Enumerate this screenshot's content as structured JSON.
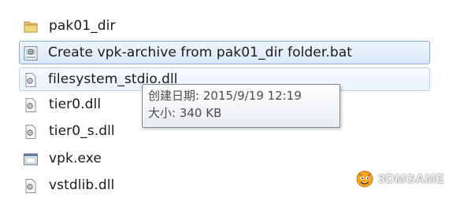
{
  "files": [
    {
      "name": "pak01_dir",
      "icon": "folder-icon"
    },
    {
      "name": "Create vpk-archive from pak01_dir folder.bat",
      "icon": "batch-file-icon"
    },
    {
      "name": "filesystem_stdio.dll",
      "icon": "dll-file-icon"
    },
    {
      "name": "tier0.dll",
      "icon": "dll-file-icon"
    },
    {
      "name": "tier0_s.dll",
      "icon": "dll-file-icon"
    },
    {
      "name": "vpk.exe",
      "icon": "exe-file-icon"
    },
    {
      "name": "vstdlib.dll",
      "icon": "dll-file-icon"
    }
  ],
  "tooltip": {
    "created_label": "创建日期:",
    "created_value": "2015/9/19 12:19",
    "size_label": "大小:",
    "size_value": "340 KB"
  },
  "watermark": {
    "text": "3DMGAME",
    "icon": "monster-logo-icon"
  },
  "colors": {
    "selection_border": "#84acdd",
    "selection_fill": "#dce8f8",
    "folder_yellow": "#e8c160",
    "tooltip_border": "#7a8797"
  }
}
